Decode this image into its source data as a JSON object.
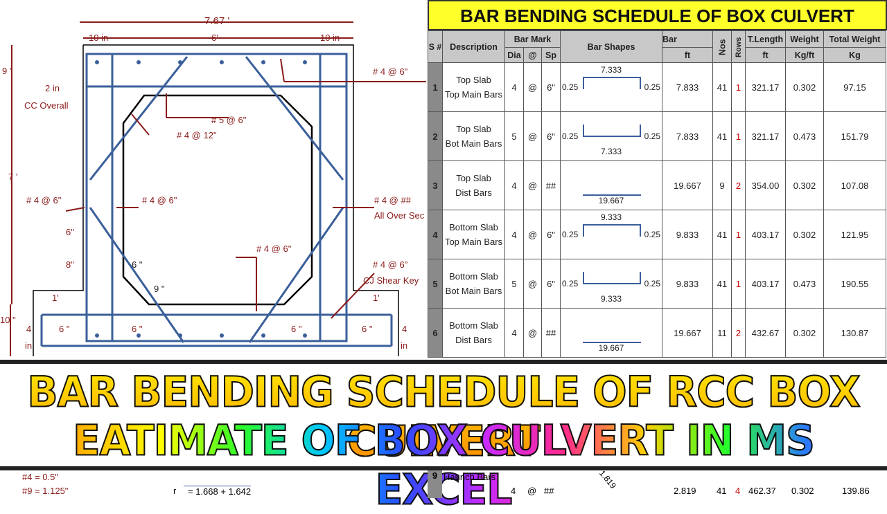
{
  "drawing": {
    "labels": [
      "7.67 '",
      "10 in",
      "6'",
      "10 in",
      "9 \"",
      "2 in",
      "CC Overall",
      "# 4 @ 6\"",
      "# 5 @ 6\"",
      "# 4 @ 12\"",
      "7 '",
      "# 4 @ 6\"",
      "# 4 @ 6\"",
      "# 4 @ ##",
      "All Over Sec",
      "6\"",
      "8\"",
      "# 4 @ 6\"",
      "6 \"",
      "9 \"",
      "# 4 @ 6\"",
      "CJ Shear Key",
      "1'",
      "1'",
      "10 \"",
      "4",
      "in",
      "6 \"",
      "6 \"",
      "6 \"",
      "6 \"",
      "4",
      "in"
    ]
  },
  "sheet": {
    "title": "BAR BENDING SCHEDULE OF BOX CULVERT",
    "headers": {
      "sn": "S #",
      "description": "Description",
      "bar_mark": "Bar Mark",
      "dia": "Dia",
      "at": "@",
      "sp": "Sp",
      "bar_shapes": "Bar Shapes",
      "bar": "Bar",
      "bar_unit": "ft",
      "nos": "Nos",
      "rows": "Rows",
      "tlength": "T.Length",
      "tlength_unit": "ft",
      "weight": "Weight",
      "weight_unit": "Kg/ft",
      "total_weight": "Total Weight",
      "total_unit": "Kg"
    },
    "rows": [
      {
        "sn": "1",
        "d1": "Top Slab",
        "d2": "Top Main Bars",
        "dia": "4",
        "at": "@",
        "sp": "6\"",
        "shape": "u",
        "top": "7.333",
        "bot": "",
        "left": "0.25",
        "right": "0.25",
        "bar": "7.833",
        "nos": "41",
        "rows": "1",
        "tl": "321.17",
        "w": "0.302",
        "tw": "97.15"
      },
      {
        "sn": "2",
        "d1": "Top Slab",
        "d2": "Bot Main Bars",
        "dia": "5",
        "at": "@",
        "sp": "6\"",
        "shape": "n",
        "top": "",
        "bot": "7.333",
        "left": "0.25",
        "right": "0.25",
        "bar": "7.833",
        "nos": "41",
        "rows": "1",
        "tl": "321.17",
        "w": "0.473",
        "tw": "151.79"
      },
      {
        "sn": "3",
        "d1": "Top Slab",
        "d2": "Dist Bars",
        "dia": "4",
        "at": "@",
        "sp": "##",
        "shape": "s",
        "top": "",
        "bot": "19.667",
        "left": "",
        "right": "",
        "bar": "19.667",
        "nos": "9",
        "rows": "2",
        "tl": "354.00",
        "w": "0.302",
        "tw": "107.08"
      },
      {
        "sn": "4",
        "d1": "Bottom Slab",
        "d2": "Top Main Bars",
        "dia": "4",
        "at": "@",
        "sp": "6\"",
        "shape": "u",
        "top": "9.333",
        "bot": "",
        "left": "0.25",
        "right": "0.25",
        "bar": "9.833",
        "nos": "41",
        "rows": "1",
        "tl": "403.17",
        "w": "0.302",
        "tw": "121.95"
      },
      {
        "sn": "5",
        "d1": "Bottom Slab",
        "d2": "Bot Main Bars",
        "dia": "5",
        "at": "@",
        "sp": "6\"",
        "shape": "n",
        "top": "",
        "bot": "9.333",
        "left": "0.25",
        "right": "0.25",
        "bar": "9.833",
        "nos": "41",
        "rows": "1",
        "tl": "403.17",
        "w": "0.473",
        "tw": "190.55"
      },
      {
        "sn": "6",
        "d1": "Bottom Slab",
        "d2": "Dist Bars",
        "dia": "4",
        "at": "@",
        "sp": "##",
        "shape": "s",
        "top": "",
        "bot": "19.667",
        "left": "",
        "right": "",
        "bar": "19.667",
        "nos": "11",
        "rows": "2",
        "tl": "432.67",
        "w": "0.302",
        "tw": "130.87"
      }
    ]
  },
  "banner": {
    "line1": "BAR BENDING SCHEDULE OF RCC BOX CULVERT",
    "line2": "EATIMATE OF BOX CULVERT IN MS EXCEL"
  },
  "bottom": {
    "n4": "#4 =  0.5\"",
    "n9": "#9 = 1.125\"",
    "r": "r",
    "formula": "= 1.668  +  1.642",
    "row": {
      "sn": "9",
      "d": "Haunch Bars",
      "dia": "4",
      "at": "@",
      "sp": "##",
      "diag": "1.819",
      "bar": "2.819",
      "nos": "41",
      "rows": "4",
      "tl": "462.37",
      "w": "0.302",
      "tw": "139.86"
    }
  },
  "colors": {
    "rebar": "#3a5f9a",
    "dimension": "#8b1a1a",
    "title_bg": "#ffff2a"
  }
}
